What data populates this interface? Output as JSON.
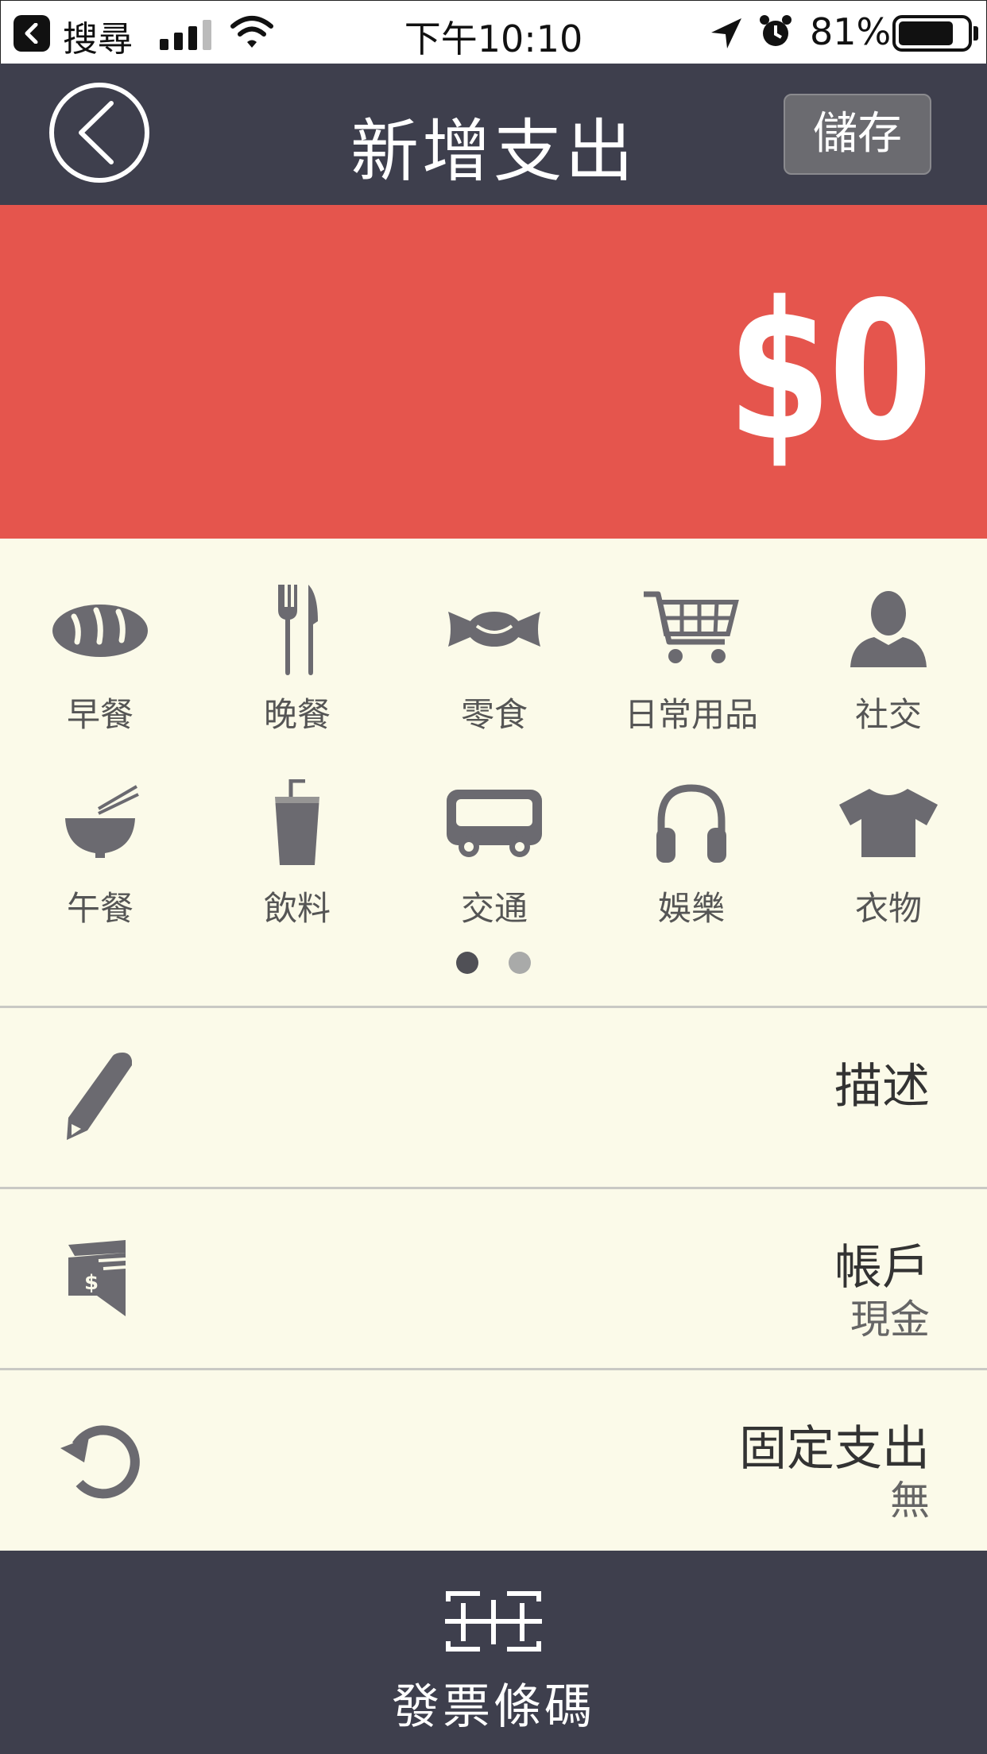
{
  "status_bar": {
    "back_app": "搜尋",
    "time": "下午10:10",
    "battery": "81%",
    "battery_level": 0.81
  },
  "nav": {
    "title": "新增支出",
    "save_label": "儲存"
  },
  "amount": {
    "value": "$0"
  },
  "categories": [
    {
      "label": "早餐",
      "icon": "bread-icon"
    },
    {
      "label": "晚餐",
      "icon": "fork-knife-icon"
    },
    {
      "label": "零食",
      "icon": "candy-icon"
    },
    {
      "label": "日常用品",
      "icon": "cart-icon"
    },
    {
      "label": "社交",
      "icon": "person-icon"
    },
    {
      "label": "午餐",
      "icon": "noodle-bowl-icon"
    },
    {
      "label": "飲料",
      "icon": "drink-cup-icon"
    },
    {
      "label": "交通",
      "icon": "bus-icon"
    },
    {
      "label": "娛樂",
      "icon": "headphones-icon"
    },
    {
      "label": "衣物",
      "icon": "tshirt-icon"
    }
  ],
  "pager": {
    "pages": 2,
    "current": 1
  },
  "fields": {
    "description": {
      "title": "描述",
      "icon": "pencil-icon"
    },
    "account": {
      "title": "帳戶",
      "value": "現金",
      "icon": "wallet-icon"
    },
    "recurring": {
      "title": "固定支出",
      "value": "無",
      "icon": "refresh-icon"
    }
  },
  "bottom": {
    "barcode_label": "發票條碼",
    "icon": "barcode-scan-icon"
  },
  "colors": {
    "nav_bg": "#3e3f4d",
    "amount_bg": "#e5554d",
    "page_bg": "#fbfae9",
    "icon_gray": "#6b6a70"
  }
}
